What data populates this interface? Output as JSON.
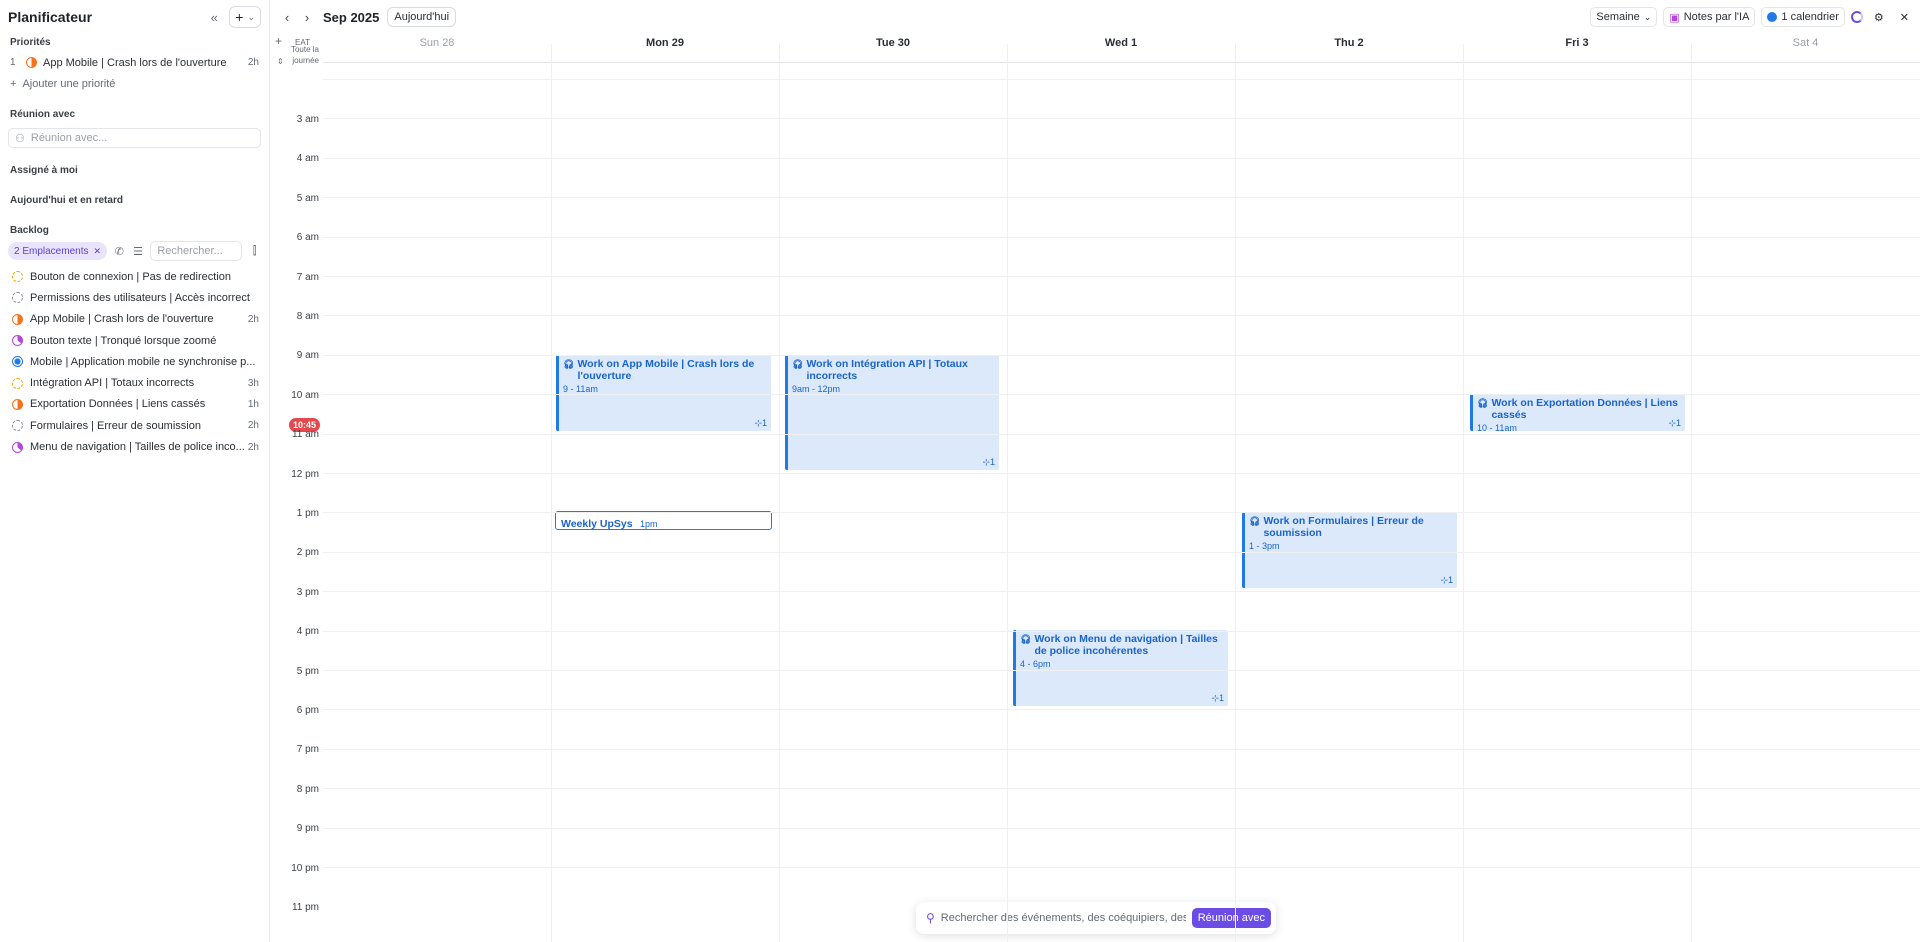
{
  "sidebar": {
    "title": "Planificateur",
    "collapse_icon": "«",
    "add_icon": "+",
    "sections": {
      "priorities": "Priorités",
      "meeting_with": "Réunion avec",
      "assigned": "Assigné à moi",
      "today_late": "Aujourd'hui et en retard",
      "backlog": "Backlog"
    },
    "priorities": [
      {
        "num": "1",
        "label": "App Mobile | Crash lors de l'ouverture",
        "duration": "2h",
        "status": "orange"
      }
    ],
    "add_priority": "Ajouter une priorité",
    "meeting_placeholder": "Réunion avec...",
    "backlog_filter_chip": "2 Emplacements",
    "backlog_search_placeholder": "Rechercher...",
    "backlog": [
      {
        "label": "Bouton de connexion | Pas de redirection",
        "duration": "",
        "status": "yellow"
      },
      {
        "label": "Permissions des utilisateurs | Accès incorrect",
        "duration": "",
        "status": "grey"
      },
      {
        "label": "App Mobile | Crash lors de l'ouverture",
        "duration": "2h",
        "status": "orange"
      },
      {
        "label": "Bouton texte | Tronqué lorsque zoomé",
        "duration": "",
        "status": "purple"
      },
      {
        "label": "Mobile | Application mobile ne synchronise p...",
        "duration": "",
        "status": "blue"
      },
      {
        "label": "Intégration API | Totaux incorrects",
        "duration": "3h",
        "status": "yellow"
      },
      {
        "label": "Exportation Données | Liens cassés",
        "duration": "1h",
        "status": "orange"
      },
      {
        "label": "Formulaires | Erreur de soumission",
        "duration": "2h",
        "status": "grey"
      },
      {
        "label": "Menu de navigation | Tailles de police inco...",
        "duration": "2h",
        "status": "purple"
      }
    ]
  },
  "calendar": {
    "month": "Sep 2025",
    "today_label": "Aujourd'hui",
    "view": "Semaine",
    "ai_notes": "Notes par l'IA",
    "calendars": "1 calendrier",
    "timezone": "EAT",
    "allday_label": "Toute la journée",
    "days": [
      "Sun 28",
      "Mon 29",
      "Tue 30",
      "Wed  1",
      "Thu  2",
      "Fri  3",
      "Sat  4"
    ],
    "hours": [
      "3 am",
      "4 am",
      "5 am",
      "6 am",
      "7 am",
      "8 am",
      "9 am",
      "10 am",
      "11 am",
      "12 pm",
      "1 pm",
      "2 pm",
      "3 pm",
      "4 pm",
      "5 pm",
      "6 pm",
      "7 pm",
      "8 pm",
      "9 pm",
      "10 pm",
      "11 pm"
    ],
    "now_time": "10:45",
    "events": [
      {
        "title": "Work on App Mobile | Crash lors de l'ouverture",
        "time": "9 - 11am",
        "badge": "⊹1"
      },
      {
        "title": "Work on Intégration API | Totaux incorrects",
        "time": "9am - 12pm",
        "badge": "⊹1"
      },
      {
        "title": "Work on Exportation Données | Liens cassés",
        "time": "10 - 11am",
        "badge": "⊹1"
      },
      {
        "title": "Weekly UpSys",
        "time": "1pm",
        "badge": ""
      },
      {
        "title": "Work on Formulaires | Erreur de soumission",
        "time": "1 - 3pm",
        "badge": "⊹1"
      },
      {
        "title": "Work on Menu de navigation | Tailles de police incohérentes",
        "time": "4 - 6pm",
        "badge": "⊹1"
      }
    ],
    "search_placeholder": "Rechercher des événements, des coéquipiers, des...",
    "search_button": "Réunion avec"
  }
}
